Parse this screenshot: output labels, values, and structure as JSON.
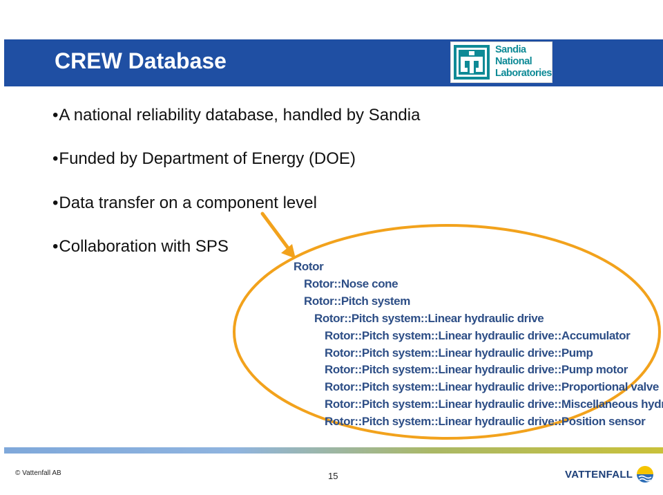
{
  "slide": {
    "title": "CREW Database",
    "logo_text": [
      "Sandia",
      "National",
      "Laboratories"
    ]
  },
  "bullets": [
    "A national reliability database, handled by Sandia",
    "Funded by Department of Energy (DOE)",
    "Data transfer on a component level",
    "Collaboration with SPS"
  ],
  "component_tree": [
    "Rotor",
    "Rotor::Nose cone",
    "Rotor::Pitch system",
    "Rotor::Pitch system::Linear hydraulic drive",
    "Rotor::Pitch system::Linear hydraulic drive::Accumulator",
    "Rotor::Pitch system::Linear hydraulic drive::Pump",
    "Rotor::Pitch system::Linear hydraulic drive::Pump motor",
    "Rotor::Pitch system::Linear hydraulic drive::Proportional valve",
    "Rotor::Pitch system::Linear hydraulic drive::Miscellaneous hydraulic",
    "Rotor::Pitch system::Linear hydraulic drive::Position sensor"
  ],
  "footer": {
    "copyright": "© Vattenfall AB",
    "page_number": "15",
    "brand": "VATTENFALL"
  },
  "colors": {
    "header": "#1f4fa3",
    "highlight": "#f2a21c",
    "tree_text": "#2d4e86"
  }
}
